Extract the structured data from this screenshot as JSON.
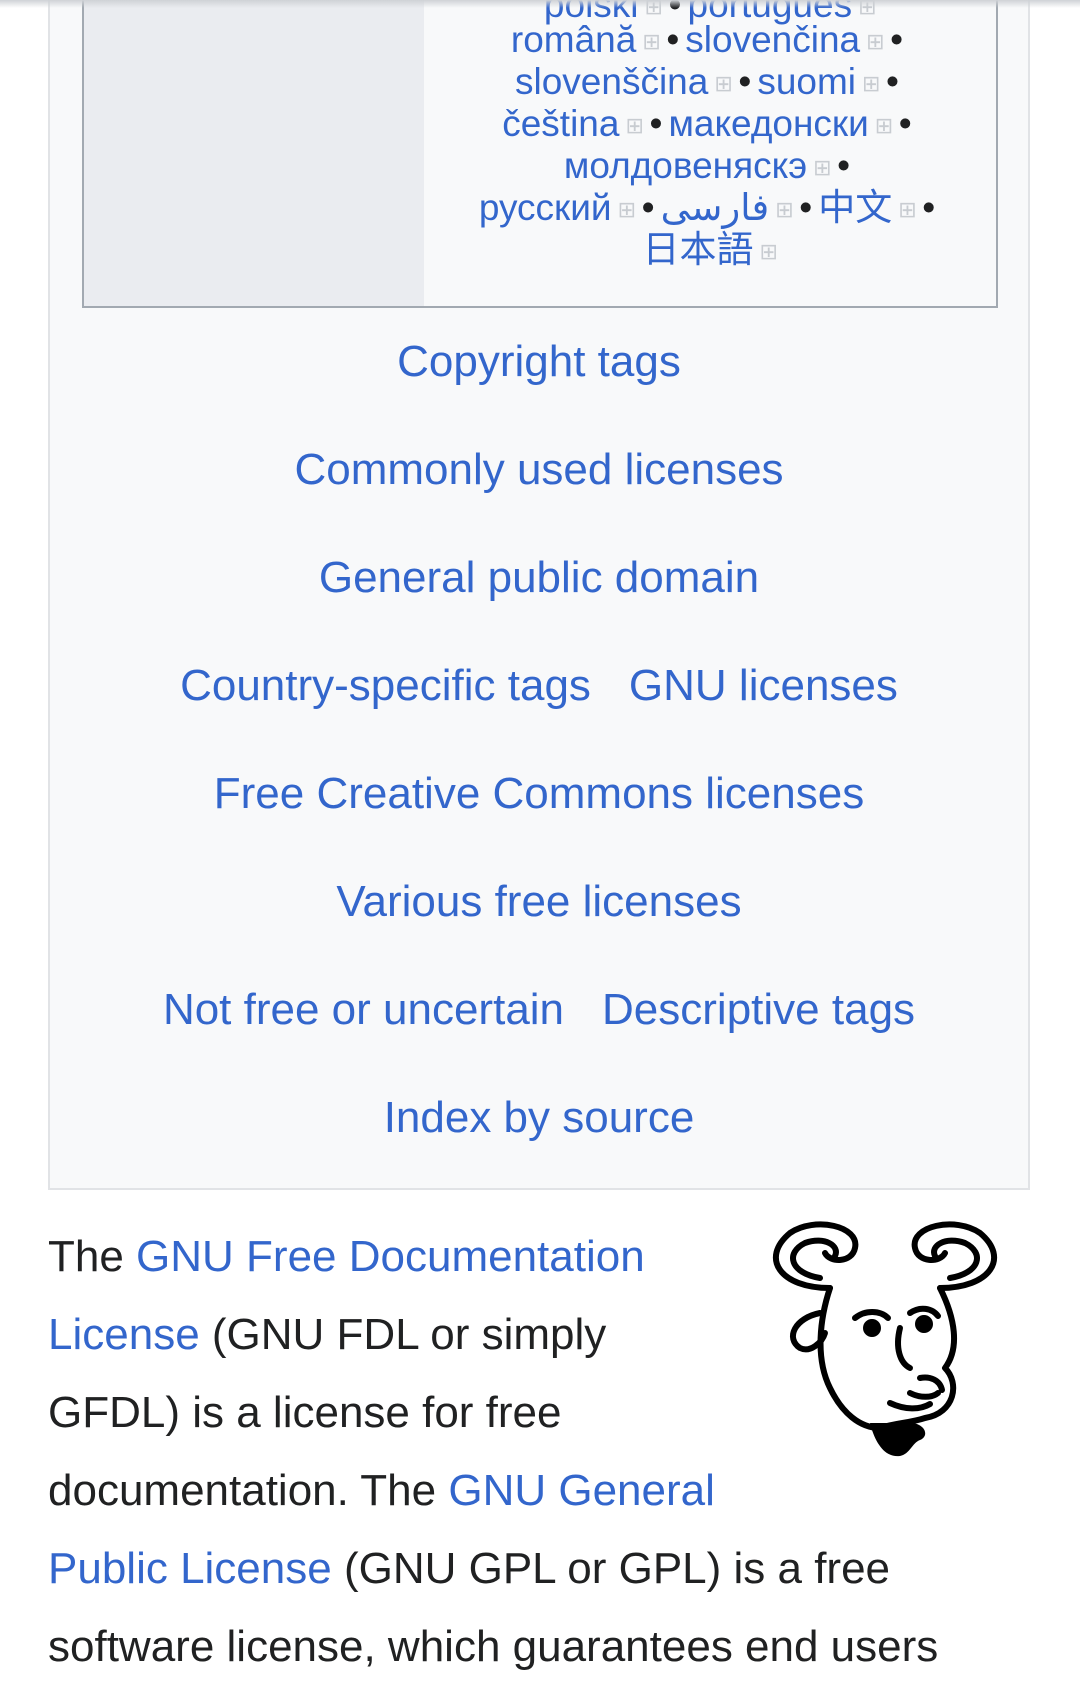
{
  "languages": {
    "line0": [
      {
        "label": "polski"
      },
      {
        "label": "português"
      }
    ],
    "line1": [
      {
        "label": "română"
      },
      {
        "label": "slovenčina"
      }
    ],
    "line2": [
      {
        "label": "slovenščina"
      },
      {
        "label": "suomi"
      }
    ],
    "line3": [
      {
        "label": "čeština"
      },
      {
        "label": "македонски"
      }
    ],
    "line4": [
      {
        "label": "молдовеняскэ"
      }
    ],
    "line5": [
      {
        "label": "русский"
      },
      {
        "label": "فارسی"
      },
      {
        "label": "中文"
      }
    ],
    "line6": [
      {
        "label": "日本語"
      }
    ],
    "separator": "•",
    "expand_glyph": "⊞"
  },
  "nav": {
    "copyright_tags": "Copyright tags",
    "commonly_used_licenses": "Commonly used licenses",
    "general_public_domain": "General public domain",
    "country_specific_tags": "Country-specific tags",
    "gnu_licenses": "GNU licenses",
    "free_cc_licenses": "Free Creative Commons licenses",
    "various_free_licenses": "Various free licenses",
    "not_free_or_uncertain": "Not free or uncertain",
    "descriptive_tags": "Descriptive tags",
    "index_by_source": "Index by source"
  },
  "article": {
    "t1": "The ",
    "link_gfdl_1": "GNU Free Documentation",
    "link_gfdl_2": "License",
    "t2": " (GNU FDL or simply",
    "t3": "GFDL) is a license for free",
    "t4": "documentation. The ",
    "link_gpl_1": "GNU General",
    "link_gpl_2": "Public License",
    "t5": " (GNU GPL or GPL) is a free",
    "t6": "software license, which guarantees end users"
  },
  "colors": {
    "link": "#3366cc",
    "text": "#202122",
    "panel_bg": "#f8f9fa",
    "border": "#a2a9b1"
  }
}
